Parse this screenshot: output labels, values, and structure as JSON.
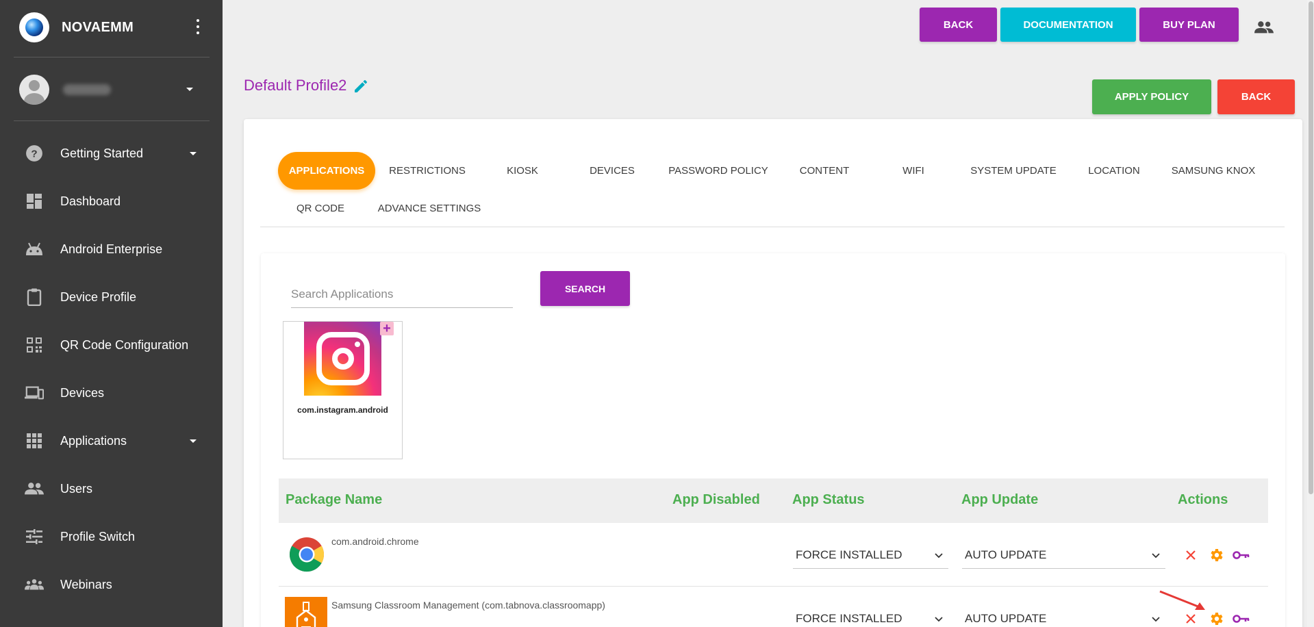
{
  "brand": {
    "name": "NOVAEMM"
  },
  "sidebar": {
    "items": [
      {
        "label": "Getting Started",
        "icon": "help-circle-icon",
        "has_caret": true
      },
      {
        "label": "Dashboard",
        "icon": "dashboard-icon"
      },
      {
        "label": "Android Enterprise",
        "icon": "android-icon"
      },
      {
        "label": "Device Profile",
        "icon": "clipboard-icon"
      },
      {
        "label": "QR Code Configuration",
        "icon": "qr-code-icon"
      },
      {
        "label": "Devices",
        "icon": "devices-icon"
      },
      {
        "label": "Applications",
        "icon": "apps-grid-icon",
        "has_caret": true
      },
      {
        "label": "Users",
        "icon": "people-icon"
      },
      {
        "label": "Profile Switch",
        "icon": "tune-icon"
      },
      {
        "label": "Webinars",
        "icon": "groups-icon"
      }
    ]
  },
  "header": {
    "back_label": "BACK",
    "documentation_label": "DOCUMENTATION",
    "buy_plan_label": "BUY PLAN"
  },
  "profile": {
    "title": "Default Profile2",
    "apply_policy_label": "APPLY POLICY",
    "back_label": "BACK"
  },
  "tabs": [
    {
      "label": "APPLICATIONS",
      "active": true
    },
    {
      "label": "RESTRICTIONS"
    },
    {
      "label": "KIOSK"
    },
    {
      "label": "DEVICES"
    },
    {
      "label": "PASSWORD POLICY"
    },
    {
      "label": "CONTENT"
    },
    {
      "label": "WIFI"
    },
    {
      "label": "SYSTEM UPDATE"
    },
    {
      "label": "LOCATION"
    },
    {
      "label": "SAMSUNG KNOX"
    },
    {
      "label": "QR CODE"
    },
    {
      "label": "ADVANCE SETTINGS"
    }
  ],
  "search": {
    "placeholder": "Search Applications",
    "value": "",
    "button_label": "SEARCH"
  },
  "search_results": [
    {
      "package": "com.instagram.android",
      "icon": "instagram-icon"
    }
  ],
  "table": {
    "headers": [
      "Package Name",
      "App Disabled",
      "App Status",
      "App Update",
      "Actions"
    ],
    "rows": [
      {
        "package": "com.android.chrome",
        "icon": "chrome-icon",
        "status": "FORCE INSTALLED",
        "update": "AUTO UPDATE"
      },
      {
        "package": "Samsung Classroom Management (com.tabnova.classroomapp)",
        "icon": "classroom-icon",
        "status": "FORCE INSTALLED",
        "update": "AUTO UPDATE"
      }
    ]
  },
  "colors": {
    "sidebar_bg": "#3a3a3a",
    "primary_purple": "#9c27b0",
    "cyan": "#00bcd4",
    "green": "#4caf50",
    "red": "#f44336",
    "orange": "#ff9800"
  }
}
